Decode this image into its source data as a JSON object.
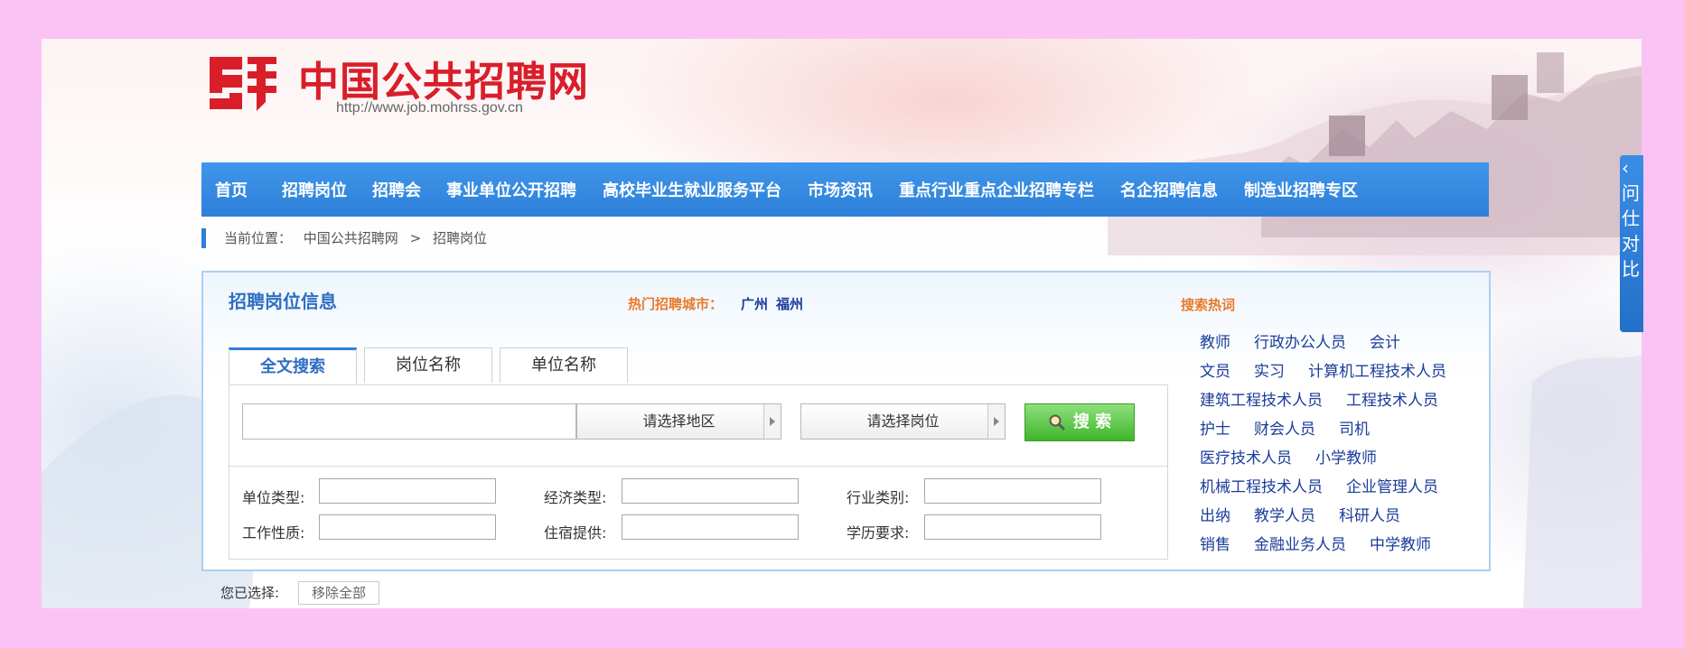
{
  "site": {
    "logo_char": "聘",
    "title": "中国公共招聘网",
    "url": "http://www.job.mohrss.gov.cn"
  },
  "nav": {
    "items": [
      "首页",
      "招聘岗位",
      "招聘会",
      "事业单位公开招聘",
      "高校毕业生就业服务平台",
      "市场资讯",
      "重点行业重点企业招聘专栏",
      "名企招聘信息",
      "制造业招聘专区"
    ]
  },
  "breadcrumb": {
    "label": "当前位置：",
    "home": "中国公共招聘网",
    "sep": ">",
    "current": "招聘岗位"
  },
  "panel": {
    "title": "招聘岗位信息",
    "hot_city_label": "热门招聘城市：",
    "hot_cities": [
      "广州",
      "福州"
    ],
    "keywords_label": "搜索热词",
    "keyword_lines": [
      [
        "教师",
        "行政办公人员",
        "会计"
      ],
      [
        "文员",
        "实习",
        "计算机工程技术人员"
      ],
      [
        "建筑工程技术人员",
        "工程技术人员"
      ],
      [
        "护士",
        "财会人员",
        "司机"
      ],
      [
        "医疗技术人员",
        "小学教师"
      ],
      [
        "机械工程技术人员",
        "企业管理人员"
      ],
      [
        "出纳",
        "教学人员",
        "科研人员"
      ],
      [
        "销售",
        "金融业务人员",
        "中学教师"
      ]
    ]
  },
  "tabs": [
    "全文搜索",
    "岗位名称",
    "单位名称"
  ],
  "search": {
    "keyword_value": "",
    "region_select": "请选择地区",
    "position_select": "请选择岗位",
    "button_label": "搜 索"
  },
  "filters": {
    "unit_type": "单位类型:",
    "econ_type": "经济类型:",
    "industry": "行业类别:",
    "job_nature": "工作性质:",
    "housing": "住宿提供:",
    "education": "学历要求:"
  },
  "selection": {
    "label": "您已选择:",
    "remove_all": "移除全部"
  },
  "side_tab": {
    "chars": "‹ 问 仕 对 比"
  },
  "colors": {
    "nav_blue": "#2e7fd8",
    "brand_red": "#d91e2a",
    "hot_orange": "#e97a2c",
    "link_blue": "#1b3c9a",
    "search_green": "#3fb52a"
  }
}
